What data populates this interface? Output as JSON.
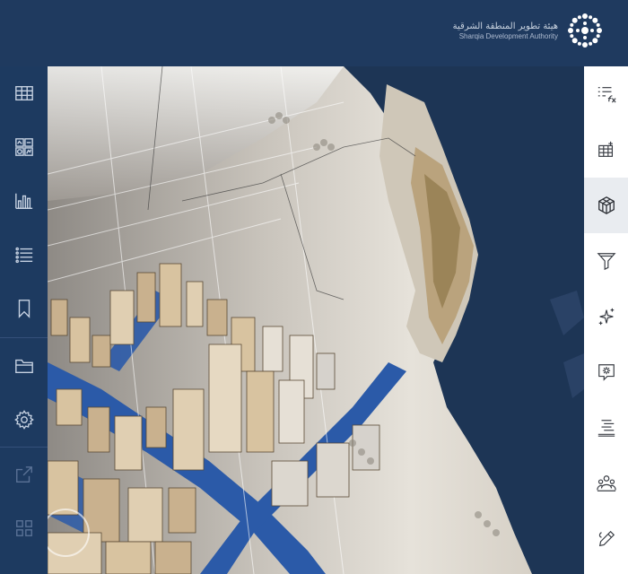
{
  "header": {
    "org_name_ar": "هيئة تطوير المنطقة الشرقية",
    "org_name_en": "Sharqia Development Authority",
    "logo_icon": "sda-logo-icon"
  },
  "left_rail": {
    "items": [
      {
        "icon": "table-icon"
      },
      {
        "icon": "widgets-icon"
      },
      {
        "icon": "bar-chart-icon"
      },
      {
        "icon": "list-icon"
      },
      {
        "icon": "bookmark-icon"
      },
      {
        "icon": "folder-icon"
      },
      {
        "icon": "settings-icon"
      },
      {
        "icon": "share-icon"
      },
      {
        "icon": "grid-icon"
      }
    ]
  },
  "right_rail": {
    "items": [
      {
        "icon": "attribute-expression-icon"
      },
      {
        "icon": "table-add-icon"
      },
      {
        "icon": "3d-cube-icon",
        "active": true
      },
      {
        "icon": "filter-icon"
      },
      {
        "icon": "sparkle-icon"
      },
      {
        "icon": "chat-settings-icon"
      },
      {
        "icon": "align-icon"
      },
      {
        "icon": "people-icon"
      },
      {
        "icon": "pencil-icon"
      }
    ]
  },
  "colors": {
    "topbar": "#1f3a5f",
    "rail_bg": "#1d3a60",
    "sea": "#1d3555",
    "land": "#d9d4cb",
    "accent_blue": "#2b5aa8",
    "building": "#c9b18e"
  }
}
